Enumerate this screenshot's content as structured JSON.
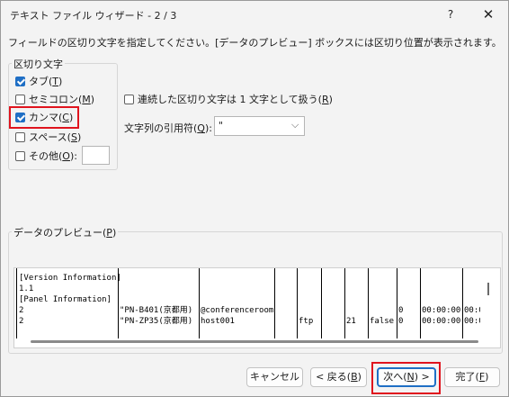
{
  "window": {
    "title": "テキスト ファイル ウィザード - 2 / 3",
    "help": "?",
    "close": "✕"
  },
  "description": "フィールドの区切り文字を指定してください。[データのプレビュー] ボックスには区切り位置が表示されます。",
  "delimiters": {
    "label": "区切り文字",
    "tab": {
      "label": "タブ(",
      "key": "T",
      "end": ")",
      "checked": true
    },
    "semicolon": {
      "label": "セミコロン(",
      "key": "M",
      "end": ")",
      "checked": false
    },
    "comma": {
      "label": "カンマ(",
      "key": "C",
      "end": ")",
      "checked": true
    },
    "space": {
      "label": "スペース(",
      "key": "S",
      "end": ")",
      "checked": false
    },
    "other": {
      "label": "その他(",
      "key": "O",
      "end": "):",
      "checked": false,
      "value": ""
    }
  },
  "consecutive": {
    "label": "連続した区切り文字は 1 文字として扱う(",
    "key": "R",
    "end": ")",
    "checked": false
  },
  "qualifier": {
    "label": "文字列の引用符(",
    "key": "Q",
    "end": "):",
    "value": "\"",
    "chevron": "⌵"
  },
  "preview": {
    "label": "データのプレビュー(",
    "key": "P",
    "end": ")",
    "col1": [
      "[Version Information]",
      "1.1",
      "[Panel Information]",
      "2",
      "2"
    ],
    "col2": [
      "",
      "",
      "",
      "\"PN-B401(京都用)",
      "\"PN-ZP35(京都用)"
    ],
    "col3": [
      "",
      "",
      "",
      "@conferenceroom",
      "host001"
    ],
    "col5": [
      "",
      "",
      "",
      "",
      "ftp"
    ],
    "col7": [
      "",
      "",
      "",
      "",
      "21"
    ],
    "col8": [
      "",
      "",
      "",
      "",
      "false"
    ],
    "col9": [
      "",
      "",
      "",
      "0",
      "0"
    ],
    "col10": [
      "",
      "",
      "",
      "00:00:00",
      "00:00:00"
    ],
    "col11": [
      "",
      "",
      "",
      "00:0",
      "00:0"
    ]
  },
  "buttons": {
    "cancel": "キャンセル",
    "back": "< 戻る(",
    "back_key": "B",
    "back_end": ")",
    "next": "次へ(",
    "next_key": "N",
    "next_end": ") >",
    "finish": "完了(",
    "finish_key": "F",
    "finish_end": ")"
  }
}
